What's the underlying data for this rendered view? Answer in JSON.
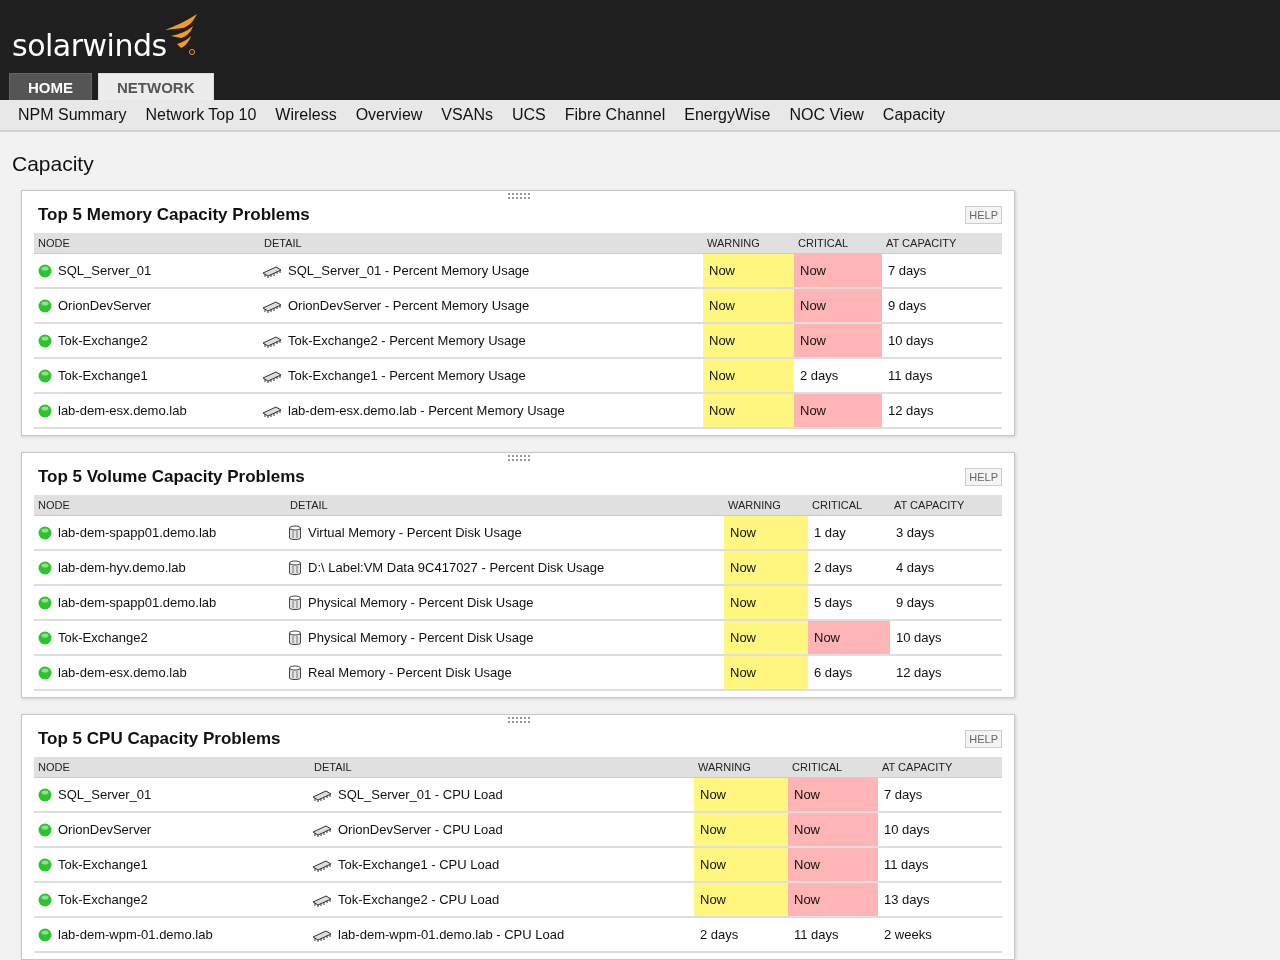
{
  "header": {
    "logo": "solarwinds"
  },
  "tabs": [
    {
      "label": "HOME",
      "selected": false
    },
    {
      "label": "NETWORK",
      "selected": true
    }
  ],
  "subnav": [
    "NPM Summary",
    "Network Top 10",
    "Wireless",
    "Overview",
    "VSANs",
    "UCS",
    "Fibre Channel",
    "EnergyWise",
    "NOC View",
    "Capacity"
  ],
  "page_title": "Capacity",
  "panels": [
    {
      "title": "Top 5 Memory Capacity Problems",
      "help": "HELP",
      "kind": "memory",
      "columns": [
        "NODE",
        "DETAIL",
        "WARNING",
        "CRITICAL",
        "AT CAPACITY"
      ],
      "rows": [
        {
          "node": "SQL_Server_01",
          "detail": "SQL_Server_01 - Percent Memory Usage",
          "warning": {
            "text": "Now",
            "highlighted": true
          },
          "critical": {
            "text": "Now",
            "highlighted": true
          },
          "at_capacity": "7 days"
        },
        {
          "node": "OrionDevServer",
          "detail": "OrionDevServer - Percent Memory Usage",
          "warning": {
            "text": "Now",
            "highlighted": true
          },
          "critical": {
            "text": "Now",
            "highlighted": true
          },
          "at_capacity": "9 days"
        },
        {
          "node": "Tok-Exchange2",
          "detail": "Tok-Exchange2 - Percent Memory Usage",
          "warning": {
            "text": "Now",
            "highlighted": true
          },
          "critical": {
            "text": "Now",
            "highlighted": true
          },
          "at_capacity": "10 days"
        },
        {
          "node": "Tok-Exchange1",
          "detail": "Tok-Exchange1 - Percent Memory Usage",
          "warning": {
            "text": "Now",
            "highlighted": true
          },
          "critical": {
            "text": "2 days",
            "highlighted": false
          },
          "at_capacity": "11 days"
        },
        {
          "node": "lab-dem-esx.demo.lab",
          "detail": "lab-dem-esx.demo.lab - Percent Memory Usage",
          "warning": {
            "text": "Now",
            "highlighted": true
          },
          "critical": {
            "text": "Now",
            "highlighted": true
          },
          "at_capacity": "12 days"
        }
      ]
    },
    {
      "title": "Top 5 Volume Capacity Problems",
      "help": "HELP",
      "kind": "disk",
      "columns": [
        "NODE",
        "DETAIL",
        "WARNING",
        "CRITICAL",
        "AT CAPACITY"
      ],
      "rows": [
        {
          "node": "lab-dem-spapp01.demo.lab",
          "detail": "Virtual Memory - Percent Disk Usage",
          "warning": {
            "text": "Now",
            "highlighted": true
          },
          "critical": {
            "text": "1 day",
            "highlighted": false
          },
          "at_capacity": "3 days"
        },
        {
          "node": "lab-dem-hyv.demo.lab",
          "detail": "D:\\ Label:VM Data 9C417027 - Percent Disk Usage",
          "warning": {
            "text": "Now",
            "highlighted": true
          },
          "critical": {
            "text": "2 days",
            "highlighted": false
          },
          "at_capacity": "4 days"
        },
        {
          "node": "lab-dem-spapp01.demo.lab",
          "detail": "Physical Memory - Percent Disk Usage",
          "warning": {
            "text": "Now",
            "highlighted": true
          },
          "critical": {
            "text": "5 days",
            "highlighted": false
          },
          "at_capacity": "9 days"
        },
        {
          "node": "Tok-Exchange2",
          "detail": "Physical Memory - Percent Disk Usage",
          "warning": {
            "text": "Now",
            "highlighted": true
          },
          "critical": {
            "text": "Now",
            "highlighted": true
          },
          "at_capacity": "10 days"
        },
        {
          "node": "lab-dem-esx.demo.lab",
          "detail": "Real Memory - Percent Disk Usage",
          "warning": {
            "text": "Now",
            "highlighted": true
          },
          "critical": {
            "text": "6 days",
            "highlighted": false
          },
          "at_capacity": "12 days"
        }
      ]
    },
    {
      "title": "Top 5 CPU Capacity Problems",
      "help": "HELP",
      "kind": "cpu",
      "columns": [
        "NODE",
        "DETAIL",
        "WARNING",
        "CRITICAL",
        "AT CAPACITY"
      ],
      "rows": [
        {
          "node": "SQL_Server_01",
          "detail": "SQL_Server_01 - CPU Load",
          "warning": {
            "text": "Now",
            "highlighted": true
          },
          "critical": {
            "text": "Now",
            "highlighted": true
          },
          "at_capacity": "7 days"
        },
        {
          "node": "OrionDevServer",
          "detail": "OrionDevServer - CPU Load",
          "warning": {
            "text": "Now",
            "highlighted": true
          },
          "critical": {
            "text": "Now",
            "highlighted": true
          },
          "at_capacity": "10 days"
        },
        {
          "node": "Tok-Exchange1",
          "detail": "Tok-Exchange1 - CPU Load",
          "warning": {
            "text": "Now",
            "highlighted": true
          },
          "critical": {
            "text": "Now",
            "highlighted": true
          },
          "at_capacity": "11 days"
        },
        {
          "node": "Tok-Exchange2",
          "detail": "Tok-Exchange2 - CPU Load",
          "warning": {
            "text": "Now",
            "highlighted": true
          },
          "critical": {
            "text": "Now",
            "highlighted": true
          },
          "at_capacity": "13 days"
        },
        {
          "node": "lab-dem-wpm-01.demo.lab",
          "detail": "lab-dem-wpm-01.demo.lab - CPU Load",
          "warning": {
            "text": "2 days",
            "highlighted": false
          },
          "critical": {
            "text": "11 days",
            "highlighted": false
          },
          "at_capacity": "2 weeks"
        }
      ]
    }
  ]
}
